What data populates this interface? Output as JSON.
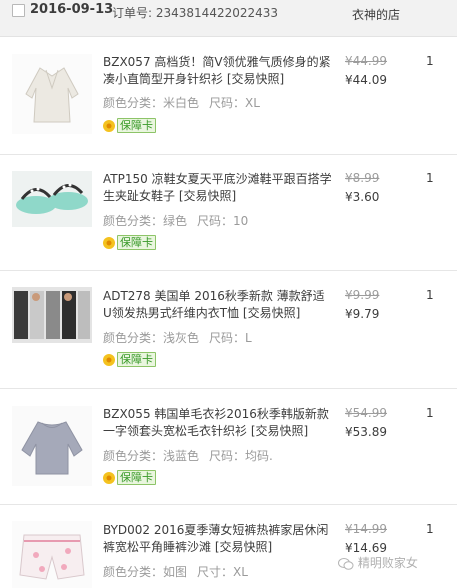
{
  "header": {
    "date": "2016-09-13",
    "order_label": "订单号:",
    "order_no": "2343814422022433",
    "shop": "衣神的店"
  },
  "items": [
    {
      "title": "BZX057 高档货！简V领优雅气质修身的紧凑小直筒型开身针织衫 [交易快照]",
      "color_label": "颜色分类：",
      "color": "米白色",
      "size_label": "尺码：",
      "size": "XL",
      "badge": "保障卡",
      "orig": "¥44.99",
      "price": "¥44.09",
      "qty": "1"
    },
    {
      "title": "ATP150 凉鞋女夏天平底沙滩鞋平跟百搭学生夹趾女鞋子 [交易快照]",
      "color_label": "颜色分类：",
      "color": "绿色",
      "size_label": "尺码：",
      "size": "10",
      "badge": "保障卡",
      "orig": "¥8.99",
      "price": "¥3.60",
      "qty": "1"
    },
    {
      "title": "ADT278 美国单 2016秋季新款 薄款舒适U领发热男式纤维内衣T恤 [交易快照]",
      "color_label": "颜色分类：",
      "color": "浅灰色",
      "size_label": "尺码：",
      "size": "L",
      "badge": "保障卡",
      "orig": "¥9.99",
      "price": "¥9.79",
      "qty": "1"
    },
    {
      "title": "BZX055 韩国单毛衣衫2016秋季韩版新款一字领套头宽松毛衣针织衫 [交易快照]",
      "color_label": "颜色分类：",
      "color": "浅蓝色",
      "size_label": "尺码：",
      "size": "均码.",
      "badge": "保障卡",
      "orig": "¥54.99",
      "price": "¥53.89",
      "qty": "1"
    },
    {
      "title": "BYD002 2016夏季薄女短裤热裤家居休闲裤宽松平角睡裤沙滩 [交易快照]",
      "color_label": "颜色分类：",
      "color": "如图",
      "size_label": "尺寸：",
      "size": "XL",
      "badge": "",
      "orig": "¥14.99",
      "price": "¥14.69",
      "qty": "1"
    }
  ],
  "watermark": "精明败家女",
  "colors": {
    "header_bg": "#f2f2f2",
    "badge_green": "#3a9a2a",
    "price_text": "#3c3c3c",
    "muted": "#9a9a9a"
  }
}
